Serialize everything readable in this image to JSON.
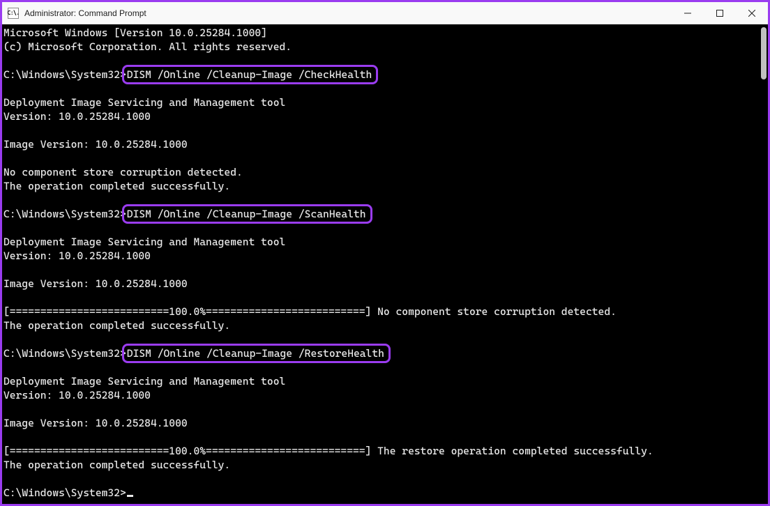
{
  "titlebar": {
    "title": "Administrator: Command Prompt",
    "app_icon_text": "C:\\."
  },
  "colors": {
    "window_border": "#9a3cf0",
    "highlight_border": "#9a3cf0",
    "terminal_fg": "#e8e8e8",
    "terminal_bg": "#000000"
  },
  "terminal": {
    "lines": [
      {
        "text": "Microsoft Windows [Version 10.0.25284.1000]"
      },
      {
        "text": "(c) Microsoft Corporation. All rights reserved."
      },
      {
        "text": ""
      },
      {
        "prompt": "C:\\Windows\\System32>",
        "command": "DISM /Online /Cleanup-Image /CheckHealth",
        "highlight": true
      },
      {
        "text": ""
      },
      {
        "text": "Deployment Image Servicing and Management tool"
      },
      {
        "text": "Version: 10.0.25284.1000"
      },
      {
        "text": ""
      },
      {
        "text": "Image Version: 10.0.25284.1000"
      },
      {
        "text": ""
      },
      {
        "text": "No component store corruption detected."
      },
      {
        "text": "The operation completed successfully."
      },
      {
        "text": ""
      },
      {
        "prompt": "C:\\Windows\\System32>",
        "command": "DISM /Online /Cleanup-Image /ScanHealth",
        "highlight": true
      },
      {
        "text": ""
      },
      {
        "text": "Deployment Image Servicing and Management tool"
      },
      {
        "text": "Version: 10.0.25284.1000"
      },
      {
        "text": ""
      },
      {
        "text": "Image Version: 10.0.25284.1000"
      },
      {
        "text": ""
      },
      {
        "text": "[==========================100.0%==========================] No component store corruption detected."
      },
      {
        "text": "The operation completed successfully."
      },
      {
        "text": ""
      },
      {
        "prompt": "C:\\Windows\\System32>",
        "command": "DISM /Online /Cleanup-Image /RestoreHealth",
        "highlight": true
      },
      {
        "text": ""
      },
      {
        "text": "Deployment Image Servicing and Management tool"
      },
      {
        "text": "Version: 10.0.25284.1000"
      },
      {
        "text": ""
      },
      {
        "text": "Image Version: 10.0.25284.1000"
      },
      {
        "text": ""
      },
      {
        "text": "[==========================100.0%==========================] The restore operation completed successfully."
      },
      {
        "text": "The operation completed successfully."
      },
      {
        "text": ""
      },
      {
        "prompt": "C:\\Windows\\System32>",
        "cursor": true
      }
    ]
  }
}
